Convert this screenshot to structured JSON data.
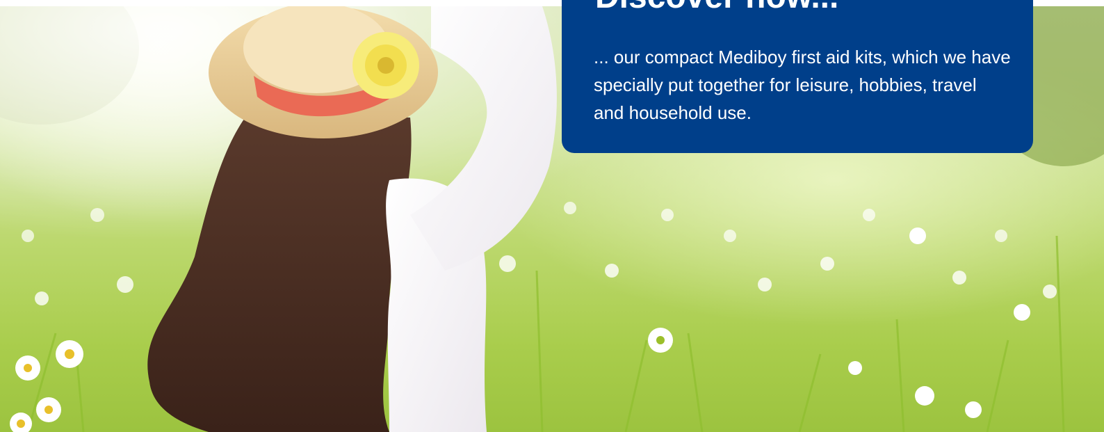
{
  "promo": {
    "title": "Discover now...",
    "text": "... our compact Mediboy first aid kits, which we have specially put together for leisure, hobbies, travel and household use."
  },
  "hero": {
    "image": "woman-in-flower-meadow-photo"
  },
  "colors": {
    "box_background": "#003f8a",
    "box_text": "#ffffff"
  }
}
